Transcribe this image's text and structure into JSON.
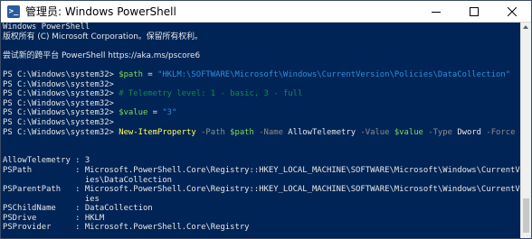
{
  "window": {
    "title": "管理员: Windows PowerShell",
    "icon": "powershell-icon"
  },
  "console": {
    "lines": [
      [
        {
          "t": "Windows PowerShell",
          "c": "plain"
        }
      ],
      [
        {
          "t": "版权所有 (C) Microsoft Corporation。保留所有权利。",
          "c": "plain"
        }
      ],
      [
        {
          "t": "",
          "c": "plain"
        }
      ],
      [
        {
          "t": "尝试新的跨平台 PowerShell https://aka.ms/pscore6",
          "c": "plain"
        }
      ],
      [
        {
          "t": "",
          "c": "plain"
        }
      ],
      [
        {
          "t": "PS C:\\Windows\\system32> ",
          "c": "plain"
        },
        {
          "t": "$path",
          "c": "var"
        },
        {
          "t": " = ",
          "c": "plain"
        },
        {
          "t": "\"HKLM:\\SOFTWARE\\Microsoft\\Windows\\CurrentVersion\\Policies\\DataCollection\"",
          "c": "str"
        }
      ],
      [
        {
          "t": "PS C:\\Windows\\system32>",
          "c": "plain"
        }
      ],
      [
        {
          "t": "PS C:\\Windows\\system32> ",
          "c": "plain"
        },
        {
          "t": "# Telemetry level: 1 - basic, 3 - full",
          "c": "cmt"
        }
      ],
      [
        {
          "t": "PS C:\\Windows\\system32>",
          "c": "plain"
        }
      ],
      [
        {
          "t": "PS C:\\Windows\\system32> ",
          "c": "plain"
        },
        {
          "t": "$value",
          "c": "var"
        },
        {
          "t": " = ",
          "c": "plain"
        },
        {
          "t": "\"3\"",
          "c": "str"
        }
      ],
      [
        {
          "t": "PS C:\\Windows\\system32>",
          "c": "plain"
        }
      ],
      [
        {
          "t": "PS C:\\Windows\\system32> ",
          "c": "plain"
        },
        {
          "t": "New-ItemProperty",
          "c": "cmd"
        },
        {
          "t": " -Path ",
          "c": "par"
        },
        {
          "t": "$path",
          "c": "var"
        },
        {
          "t": " -Name ",
          "c": "par"
        },
        {
          "t": "AllowTelemetry",
          "c": "val"
        },
        {
          "t": " -Value ",
          "c": "par"
        },
        {
          "t": "$value",
          "c": "var"
        },
        {
          "t": " -Type ",
          "c": "par"
        },
        {
          "t": "Dword",
          "c": "val"
        },
        {
          "t": " -Force",
          "c": "par"
        }
      ],
      [
        {
          "t": "",
          "c": "plain"
        }
      ],
      [
        {
          "t": "",
          "c": "plain"
        }
      ],
      [
        {
          "t": "AllowTelemetry : 3",
          "c": "plain"
        }
      ],
      [
        {
          "t": "PSPath         : Microsoft.PowerShell.Core\\Registry::HKEY_LOCAL_MACHINE\\SOFTWARE\\Microsoft\\Windows\\CurrentVers",
          "c": "plain"
        }
      ],
      [
        {
          "t": "                 ies\\DataCollection",
          "c": "plain"
        }
      ],
      [
        {
          "t": "PSParentPath   : Microsoft.PowerShell.Core\\Registry::HKEY_LOCAL_MACHINE\\SOFTWARE\\Microsoft\\Windows\\CurrentVers",
          "c": "plain"
        }
      ],
      [
        {
          "t": "                 ies",
          "c": "plain"
        }
      ],
      [
        {
          "t": "PSChildName    : DataCollection",
          "c": "plain"
        }
      ],
      [
        {
          "t": "PSDrive        : HKLM",
          "c": "plain"
        }
      ],
      [
        {
          "t": "PSProvider     : Microsoft.PowerShell.Core\\Registry",
          "c": "plain"
        }
      ]
    ]
  },
  "colors": {
    "background": "#012456",
    "variable": "#7ed957",
    "string": "#2f8fd8",
    "comment": "#0f8a4b",
    "command": "#ffff54",
    "parameter": "#8c8c8c"
  }
}
